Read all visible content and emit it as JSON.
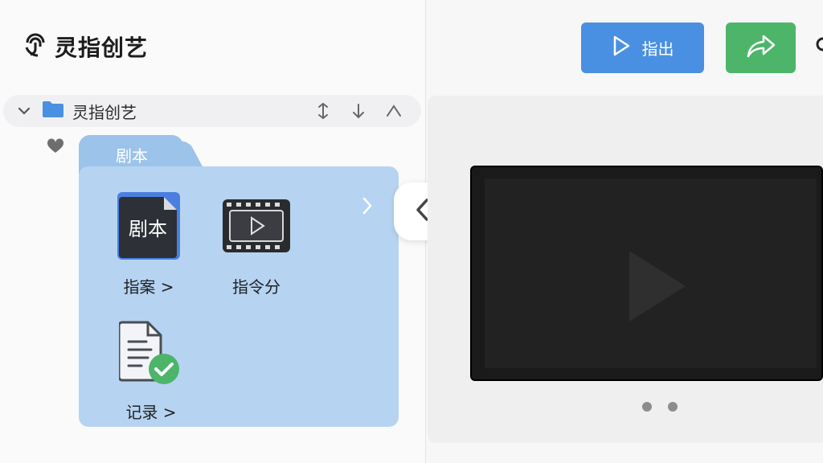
{
  "app": {
    "title": "灵指创艺"
  },
  "tree": {
    "root_label": "灵指创艺"
  },
  "folder": {
    "tab_label": "剧本",
    "items": [
      {
        "label": "指案 >",
        "icon_text": "剧本"
      },
      {
        "label": "指令分"
      },
      {
        "label": "记录 >"
      }
    ]
  },
  "toolbar": {
    "export_label": "指出"
  },
  "colors": {
    "accent_blue": "#4a90e2",
    "accent_green": "#4db56a",
    "folder_blue": "#b6d4f1"
  },
  "icons": {
    "brand": "fingerprint-logo-icon",
    "expand": "chevron-down-icon",
    "folder": "folder-icon",
    "move": "move-vertical-icon",
    "down": "arrow-down-icon",
    "collapse_up": "chevron-up-icon",
    "favorite": "heart-icon",
    "script_doc": "script-document-icon",
    "film": "film-clip-icon",
    "record": "checked-document-icon",
    "play": "play-icon",
    "share": "share-arrow-icon",
    "back": "chevron-left-icon"
  }
}
